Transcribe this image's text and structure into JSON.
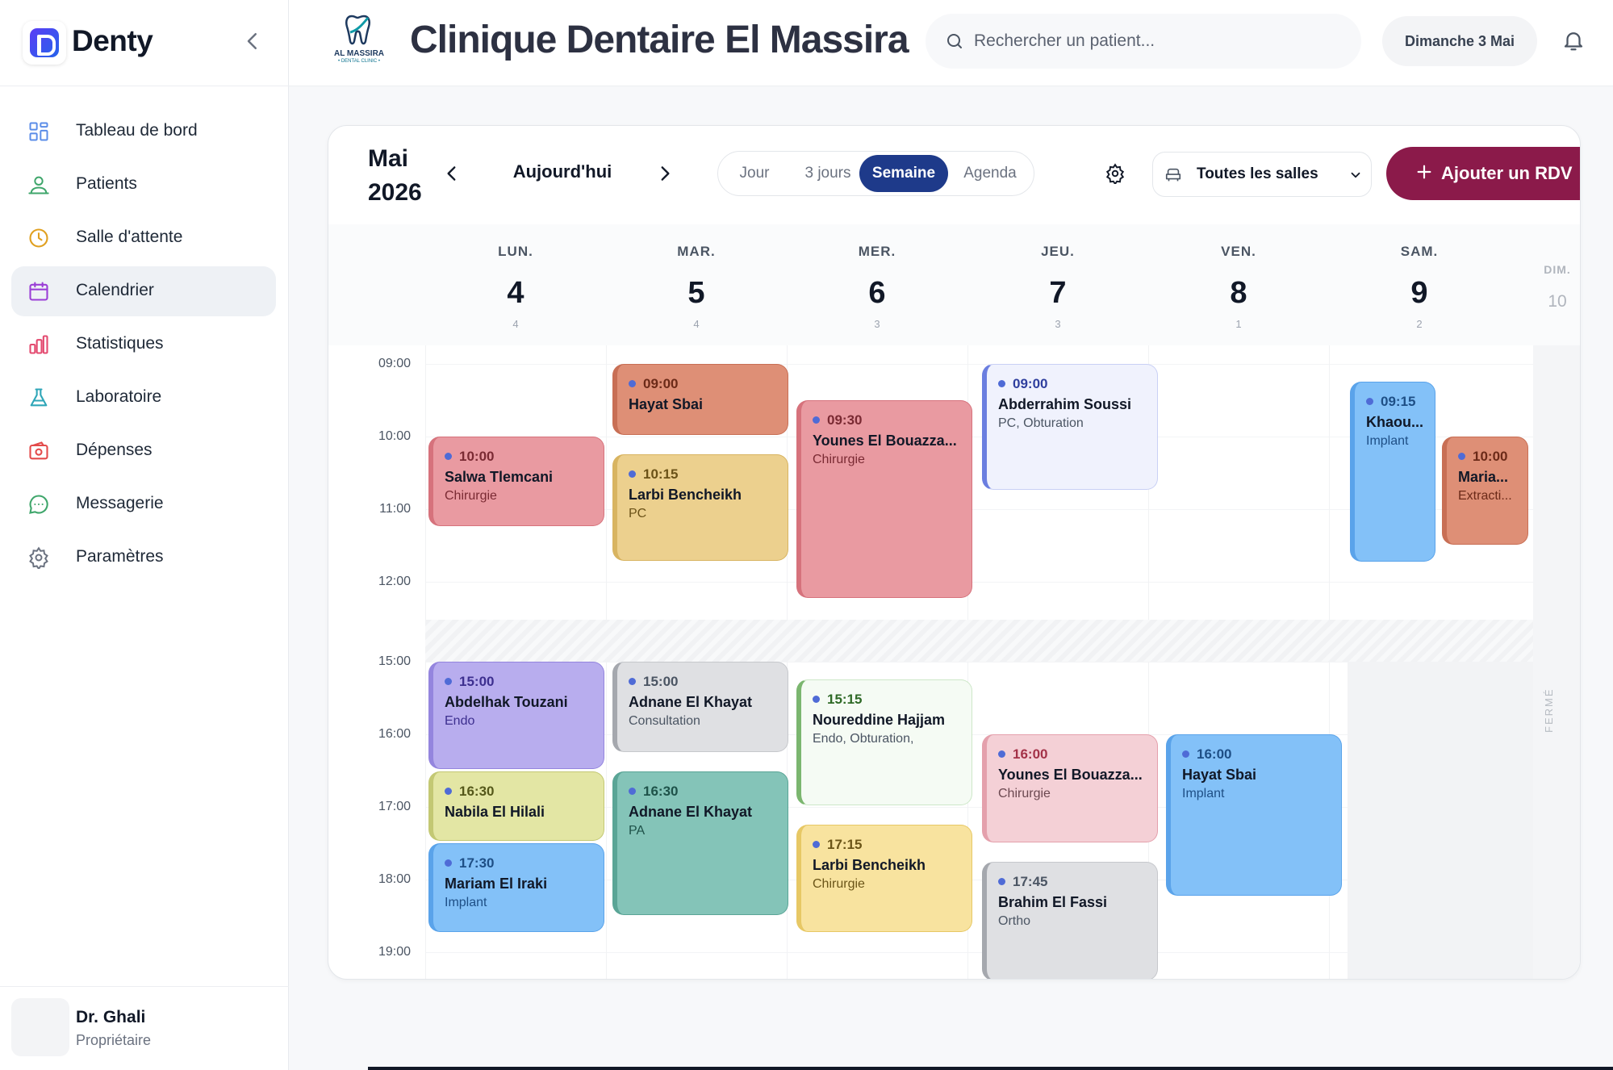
{
  "app": {
    "name": "Denty"
  },
  "sidebar": {
    "items": [
      {
        "label": "Tableau de bord",
        "icon": "grid-icon",
        "color": "#5b8de8"
      },
      {
        "label": "Patients",
        "icon": "users-icon",
        "color": "#3fa66b"
      },
      {
        "label": "Salle d'attente",
        "icon": "clock-icon",
        "color": "#e0a020"
      },
      {
        "label": "Calendrier",
        "icon": "calendar-icon",
        "color": "#9b3fd6"
      },
      {
        "label": "Statistiques",
        "icon": "bar-chart-icon",
        "color": "#e34a6f"
      },
      {
        "label": "Laboratoire",
        "icon": "flask-icon",
        "color": "#2fa6b8"
      },
      {
        "label": "Dépenses",
        "icon": "wallet-icon",
        "color": "#e34a4a"
      },
      {
        "label": "Messagerie",
        "icon": "chat-icon",
        "color": "#3fa66b"
      },
      {
        "label": "Paramètres",
        "icon": "gear-icon",
        "color": "#6b7280"
      }
    ],
    "active_index": 3,
    "user": {
      "name": "Dr. Ghali",
      "role": "Propriétaire"
    }
  },
  "header": {
    "clinic_logo_text": "AL MASSIRA",
    "clinic_logo_subtext": "• DENTAL CLINIC •",
    "clinic_title": "Clinique Dentaire El Massira",
    "search_placeholder": "Rechercher un patient...",
    "date_chip": "Dimanche 3 Mai"
  },
  "toolbar": {
    "month": "Mai",
    "year": "2026",
    "today_label": "Aujourd'hui",
    "views": [
      "Jour",
      "3 jours",
      "Semaine",
      "Agenda"
    ],
    "active_view": "Semaine",
    "room_select": "Toutes les salles",
    "add_label": "Ajouter un RDV"
  },
  "days": [
    {
      "name": "LUN.",
      "num": "4",
      "count": "4"
    },
    {
      "name": "MAR.",
      "num": "5",
      "count": "4"
    },
    {
      "name": "MER.",
      "num": "6",
      "count": "3"
    },
    {
      "name": "JEU.",
      "num": "7",
      "count": "3"
    },
    {
      "name": "VEN.",
      "num": "8",
      "count": "1"
    },
    {
      "name": "SAM.",
      "num": "9",
      "count": "2"
    }
  ],
  "sunday": {
    "name": "DIM.",
    "num": "10",
    "closed_label": "FERMÉ"
  },
  "time_labels": [
    "09:00",
    "10:00",
    "11:00",
    "12:00",
    "15:00",
    "16:00",
    "17:00",
    "18:00",
    "19:00"
  ],
  "events": [
    {
      "time": "10:00",
      "name": "Salwa Tlemcani",
      "desc": "Chirurgie"
    },
    {
      "time": "15:00",
      "name": "Abdelhak Touzani",
      "desc": "Endo"
    },
    {
      "time": "16:30",
      "name": "Nabila El Hilali",
      "desc": ""
    },
    {
      "time": "17:30",
      "name": "Mariam El Iraki",
      "desc": "Implant"
    },
    {
      "time": "09:00",
      "name": "Hayat Sbai",
      "desc": ""
    },
    {
      "time": "10:15",
      "name": "Larbi Bencheikh",
      "desc": "PC"
    },
    {
      "time": "15:00",
      "name": "Adnane El Khayat",
      "desc": "Consultation"
    },
    {
      "time": "16:30",
      "name": "Adnane El Khayat",
      "desc": "PA"
    },
    {
      "time": "09:30",
      "name": "Younes El Bouazza...",
      "desc": "Chirurgie"
    },
    {
      "time": "15:15",
      "name": "Noureddine Hajjam",
      "desc": "Endo, Obturation,"
    },
    {
      "time": "17:15",
      "name": "Larbi Bencheikh",
      "desc": "Chirurgie"
    },
    {
      "time": "09:00",
      "name": "Abderrahim Soussi",
      "desc": "PC, Obturation"
    },
    {
      "time": "16:00",
      "name": "Younes El Bouazza...",
      "desc": "Chirurgie"
    },
    {
      "time": "17:45",
      "name": "Brahim El Fassi",
      "desc": "Ortho"
    },
    {
      "time": "16:00",
      "name": "Hayat Sbai",
      "desc": "Implant"
    },
    {
      "time": "09:15",
      "name": "Khaou...",
      "desc": "Implant"
    },
    {
      "time": "10:00",
      "name": "Maria...",
      "desc": "Extracti..."
    }
  ]
}
